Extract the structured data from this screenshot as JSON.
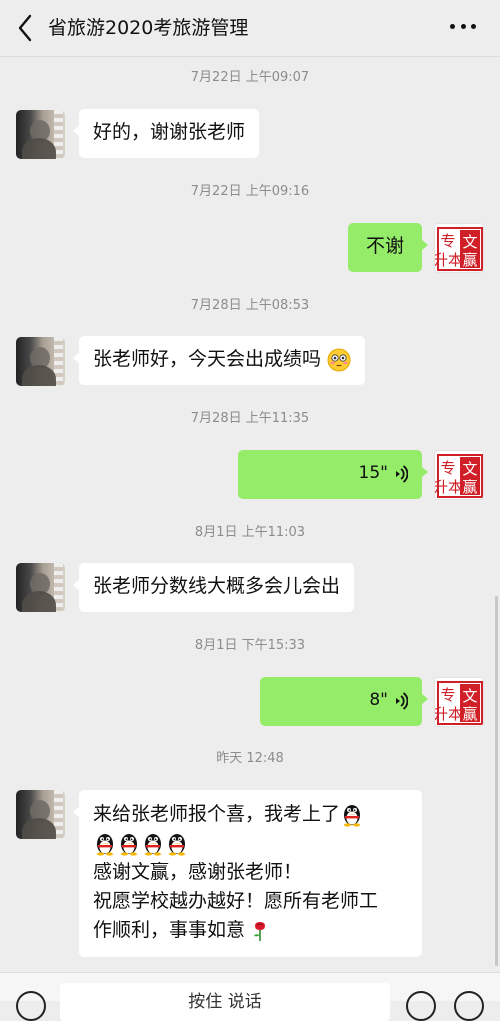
{
  "header": {
    "title": "省旅游2020考旅游管理",
    "back_icon": "chevron-left-icon",
    "more_icon": "more-dots-icon"
  },
  "logo_text": "专升本文赢",
  "messages": [
    {
      "kind": "time",
      "text": "7月22日 上午09:07"
    },
    {
      "kind": "in",
      "text": "好的，谢谢张老师"
    },
    {
      "kind": "time",
      "text": "7月22日 上午09:16"
    },
    {
      "kind": "out",
      "text": "不谢"
    },
    {
      "kind": "time",
      "text": "7月28日 上午08:53"
    },
    {
      "kind": "in",
      "text": "张老师好，今天会出成绩吗",
      "emoji": "flushed-emoji"
    },
    {
      "kind": "time",
      "text": "7月28日 上午11:35"
    },
    {
      "kind": "voice",
      "duration": "15\""
    },
    {
      "kind": "time",
      "text": "8月1日 上午11:03"
    },
    {
      "kind": "in",
      "text": "张老师分数线大概多会儿会出"
    },
    {
      "kind": "time",
      "text": "8月1日 下午15:33"
    },
    {
      "kind": "voice",
      "duration": "8\""
    },
    {
      "kind": "time",
      "text": "昨天 12:48"
    },
    {
      "kind": "in_multi",
      "lines": [
        "来给张老师报个喜，我考上了",
        "感谢文赢，感谢张老师！",
        "祝愿学校越办越好！愿所有老师工",
        "作顺利，事事如意"
      ],
      "emoji_count": 5,
      "emoji": "penguin-emoji",
      "end_emoji": "rose-emoji"
    }
  ],
  "input": {
    "placeholder": "按住 说话"
  }
}
